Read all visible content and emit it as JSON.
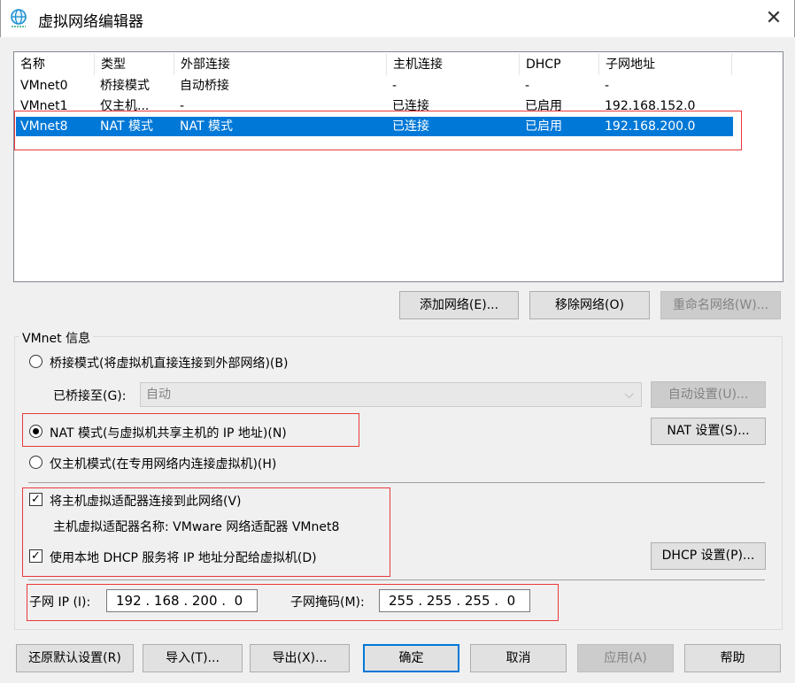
{
  "window": {
    "title": "虚拟网络编辑器",
    "close": "✕"
  },
  "table": {
    "headers": [
      "名称",
      "类型",
      "外部连接",
      "主机连接",
      "DHCP",
      "子网地址"
    ],
    "rows": [
      [
        "VMnet0",
        "桥接模式",
        "自动桥接",
        "-",
        "-",
        "-"
      ],
      [
        "VMnet1",
        "仅主机...",
        "-",
        "已连接",
        "已启用",
        "192.168.152.0"
      ],
      [
        "VMnet8",
        "NAT 模式",
        "NAT 模式",
        "已连接",
        "已启用",
        "192.168.200.0"
      ]
    ],
    "selected_index": 2
  },
  "list_buttons": {
    "add": "添加网络(E)...",
    "remove": "移除网络(O)",
    "rename": "重命名网络(W)..."
  },
  "vmnet_info": {
    "group_label": "VMnet 信息",
    "bridge_radio": "桥接模式(将虚拟机直接连接到外部网络)(B)",
    "bridged_to_label": "已桥接至(G):",
    "bridged_to_value": "自动",
    "auto_settings": "自动设置(U)...",
    "nat_radio": "NAT 模式(与虚拟机共享主机的 IP 地址)(N)",
    "nat_settings": "NAT 设置(S)...",
    "hostonly_radio": "仅主机模式(在专用网络内连接虚拟机)(H)",
    "connect_adapter": "将主机虚拟适配器连接到此网络(V)",
    "adapter_name": "主机虚拟适配器名称: VMware 网络适配器 VMnet8",
    "use_dhcp": "使用本地 DHCP 服务将 IP 地址分配给虚拟机(D)",
    "dhcp_settings": "DHCP 设置(P)...",
    "subnet_ip_label": "子网 IP (I):",
    "subnet_ip": "192 . 168 . 200 .  0",
    "subnet_mask_label": "子网掩码(M):",
    "subnet_mask": "255 . 255 . 255 .  0"
  },
  "footer": {
    "restore": "还原默认设置(R)",
    "import": "导入(T)...",
    "export": "导出(X)...",
    "ok": "确定",
    "cancel": "取消",
    "apply": "应用(A)",
    "help": "帮助"
  }
}
